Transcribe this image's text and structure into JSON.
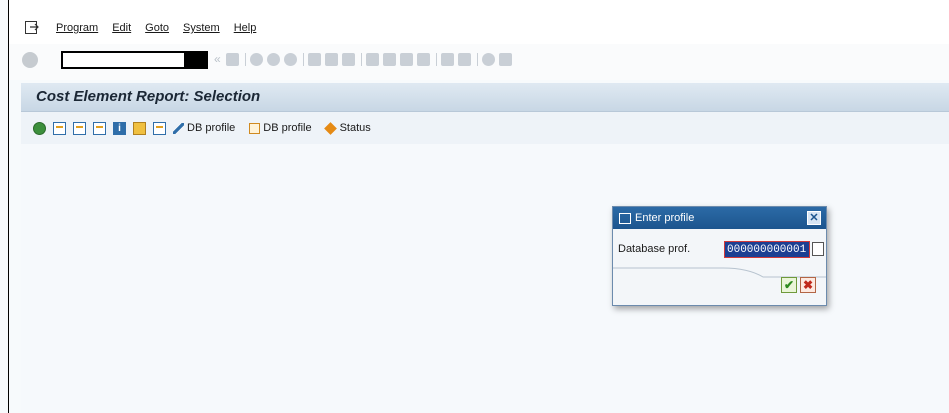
{
  "menu": {
    "items": [
      "Program",
      "Edit",
      "Goto",
      "System",
      "Help"
    ]
  },
  "system_toolbar": {
    "command_field_value": ""
  },
  "title": "Cost Element Report: Selection",
  "app_toolbar": {
    "buttons": [
      {
        "icon": "pencil-icon",
        "label": "DB profile"
      },
      {
        "icon": "copy-profile-icon",
        "label": "DB profile"
      },
      {
        "icon": "status-diamond-icon",
        "label": "Status"
      }
    ]
  },
  "dialog": {
    "title": "Enter profile",
    "close_glyph": "✕",
    "field_label": "Database prof.",
    "field_value": "000000000001",
    "ok_glyph": "✔",
    "cancel_glyph": "✖"
  },
  "colors": {
    "title_bar": "#c8d7e5",
    "dialog_title": "#1c558e",
    "input_highlight": "#1c3f92"
  }
}
